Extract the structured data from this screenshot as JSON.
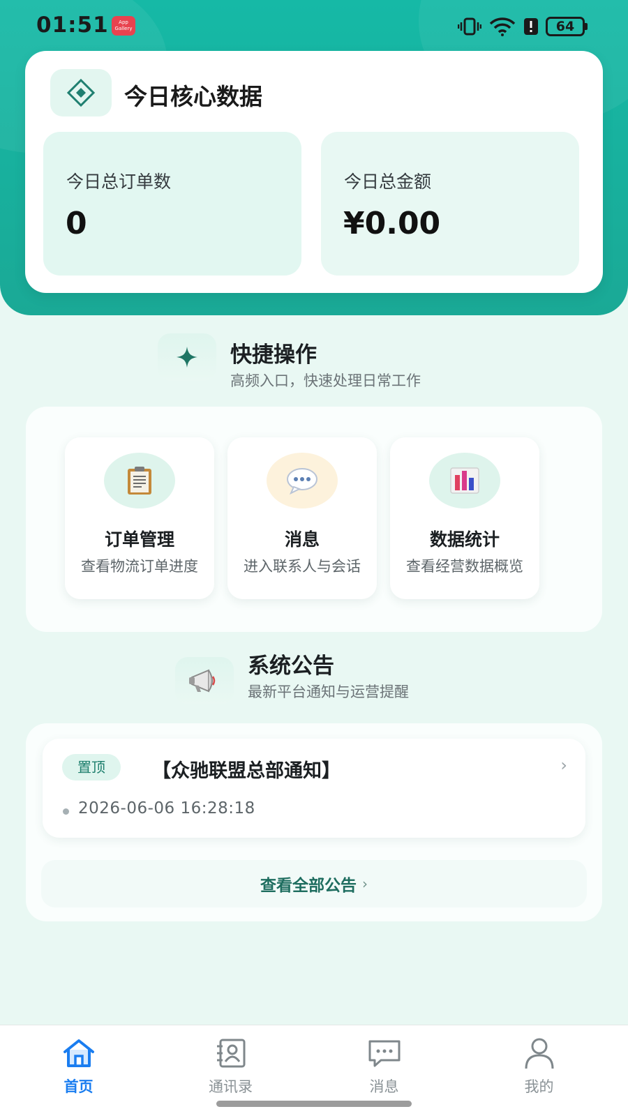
{
  "status_bar": {
    "time": "01:51",
    "app_icon_text": "App Gallery",
    "battery": "64"
  },
  "core": {
    "title": "今日核心数据",
    "stats": [
      {
        "label": "今日总订单数",
        "value": "0"
      },
      {
        "label": "今日总金额",
        "value": "¥0.00"
      }
    ]
  },
  "quick": {
    "title": "快捷操作",
    "subtitle": "高频入口，快速处理日常工作",
    "items": [
      {
        "title": "订单管理",
        "desc": "查看物流订单进度",
        "icon": "clipboard-icon"
      },
      {
        "title": "消息",
        "desc": "进入联系人与会话",
        "icon": "speech-bubble-icon"
      },
      {
        "title": "数据统计",
        "desc": "查看经营数据概览",
        "icon": "bar-chart-icon"
      }
    ]
  },
  "notices": {
    "title": "系统公告",
    "subtitle": "最新平台通知与运营提醒",
    "items": [
      {
        "badge": "置顶",
        "title": "【众驰联盟总部通知】",
        "time": "2026-06-06 16:28:18"
      }
    ],
    "view_all": "查看全部公告"
  },
  "tabs": [
    {
      "label": "首页",
      "icon": "home-icon",
      "active": true
    },
    {
      "label": "通讯录",
      "icon": "contacts-icon",
      "active": false
    },
    {
      "label": "消息",
      "icon": "message-icon",
      "active": false
    },
    {
      "label": "我的",
      "icon": "user-icon",
      "active": false
    }
  ],
  "colors": {
    "brand_teal": "#16b9a6",
    "page_bg": "#e9f8f3",
    "tab_active": "#1a7df0"
  }
}
